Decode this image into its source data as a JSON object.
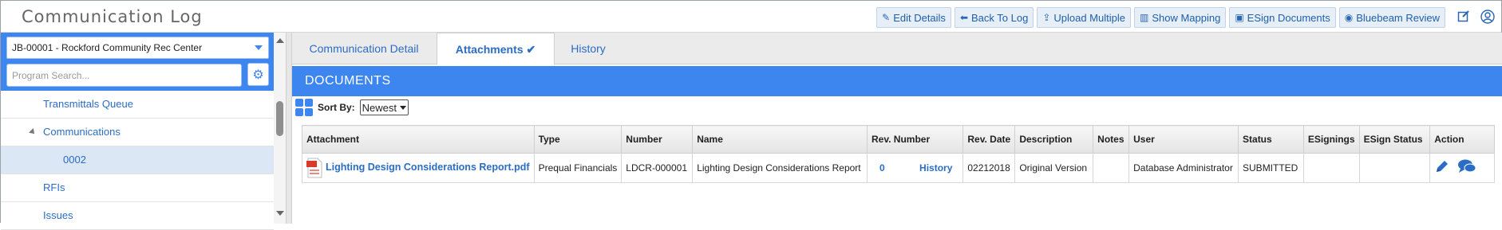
{
  "app": {
    "title": "Communication Log"
  },
  "toolbar": {
    "buttons": [
      {
        "label": "Edit Details",
        "icon": "pencil-icon"
      },
      {
        "label": "Back To Log",
        "icon": "arrow-left-icon"
      },
      {
        "label": "Upload Multiple",
        "icon": "upload-icon"
      },
      {
        "label": "Show Mapping",
        "icon": "map-icon"
      },
      {
        "label": "ESign Documents",
        "icon": "esign-icon"
      },
      {
        "label": "Bluebeam Review",
        "icon": "eye-icon"
      }
    ],
    "right_icons": [
      "edit-square-icon",
      "user-icon"
    ]
  },
  "sidebar": {
    "job": "JB-00001 - Rockford Community Rec Center",
    "search_placeholder": "Program Search...",
    "items": [
      {
        "label": "Transmittals Queue",
        "level": 1,
        "selected": false
      },
      {
        "label": "Communications",
        "level": 1,
        "expanded": true,
        "selected": false
      },
      {
        "label": "0002",
        "level": 2,
        "selected": true
      },
      {
        "label": "RFIs",
        "level": 1,
        "selected": false
      },
      {
        "label": "Issues",
        "level": 1,
        "selected": false
      }
    ]
  },
  "tabs": [
    {
      "label": "Communication Detail",
      "active": false
    },
    {
      "label": "Attachments",
      "active": true,
      "check": "✔"
    },
    {
      "label": "History",
      "active": false
    }
  ],
  "documents": {
    "title": "DOCUMENTS",
    "sort_label": "Sort By:",
    "sort_value": "Newest",
    "columns": [
      "Attachment",
      "Type",
      "Number",
      "Name",
      "Rev. Number",
      "Rev. Date",
      "Description",
      "Notes",
      "User",
      "Status",
      "ESignings",
      "ESign Status",
      "Action"
    ],
    "rows": [
      {
        "attachment": "Lighting Design Considerations Report.pdf",
        "type": "Prequal Financials",
        "number": "LDCR-000001",
        "name": "Lighting Design Considerations Report",
        "rev_number": "0",
        "rev_history": "History",
        "rev_date": "02212018",
        "description": "Original Version",
        "notes": "",
        "user": "Database Administrator",
        "status": "SUBMITTED",
        "esignings": "",
        "esign_status": ""
      }
    ]
  },
  "colors": {
    "accent": "#3d86f0",
    "link": "#2b6cc4",
    "selected_row": "#dbe7f5"
  }
}
